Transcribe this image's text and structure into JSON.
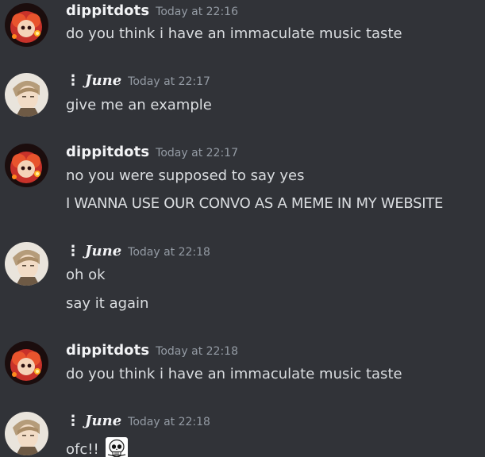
{
  "users": {
    "dippitdots": {
      "name": "dippitdots"
    },
    "june": {
      "name": "June",
      "prefix": "⋮"
    }
  },
  "messages": [
    {
      "author": "dippitdots",
      "time": "Today at 22:16",
      "lines": [
        "do you think i have an immaculate music taste"
      ]
    },
    {
      "author": "June",
      "time": "Today at 22:17",
      "lines": [
        "give me an example"
      ]
    },
    {
      "author": "dippitdots",
      "time": "Today at 22:17",
      "lines": [
        "no you were supposed to say yes",
        "I WANNA USE OUR CONVO AS A MEME IN MY WEBSITE"
      ]
    },
    {
      "author": "June",
      "time": "Today at 22:18",
      "lines": [
        "oh ok",
        "say it again"
      ]
    },
    {
      "author": "dippitdots",
      "time": "Today at 22:18",
      "lines": [
        "do you think i have an immaculate music taste"
      ]
    },
    {
      "author": "June",
      "time": "Today at 22:18",
      "lines": [
        "ofc!!"
      ],
      "emoji": "skull-emoji"
    }
  ],
  "colors": {
    "background": "#313338",
    "username": "#f2f3f5",
    "text": "#dbdee1",
    "timestamp": "#949ba4"
  }
}
